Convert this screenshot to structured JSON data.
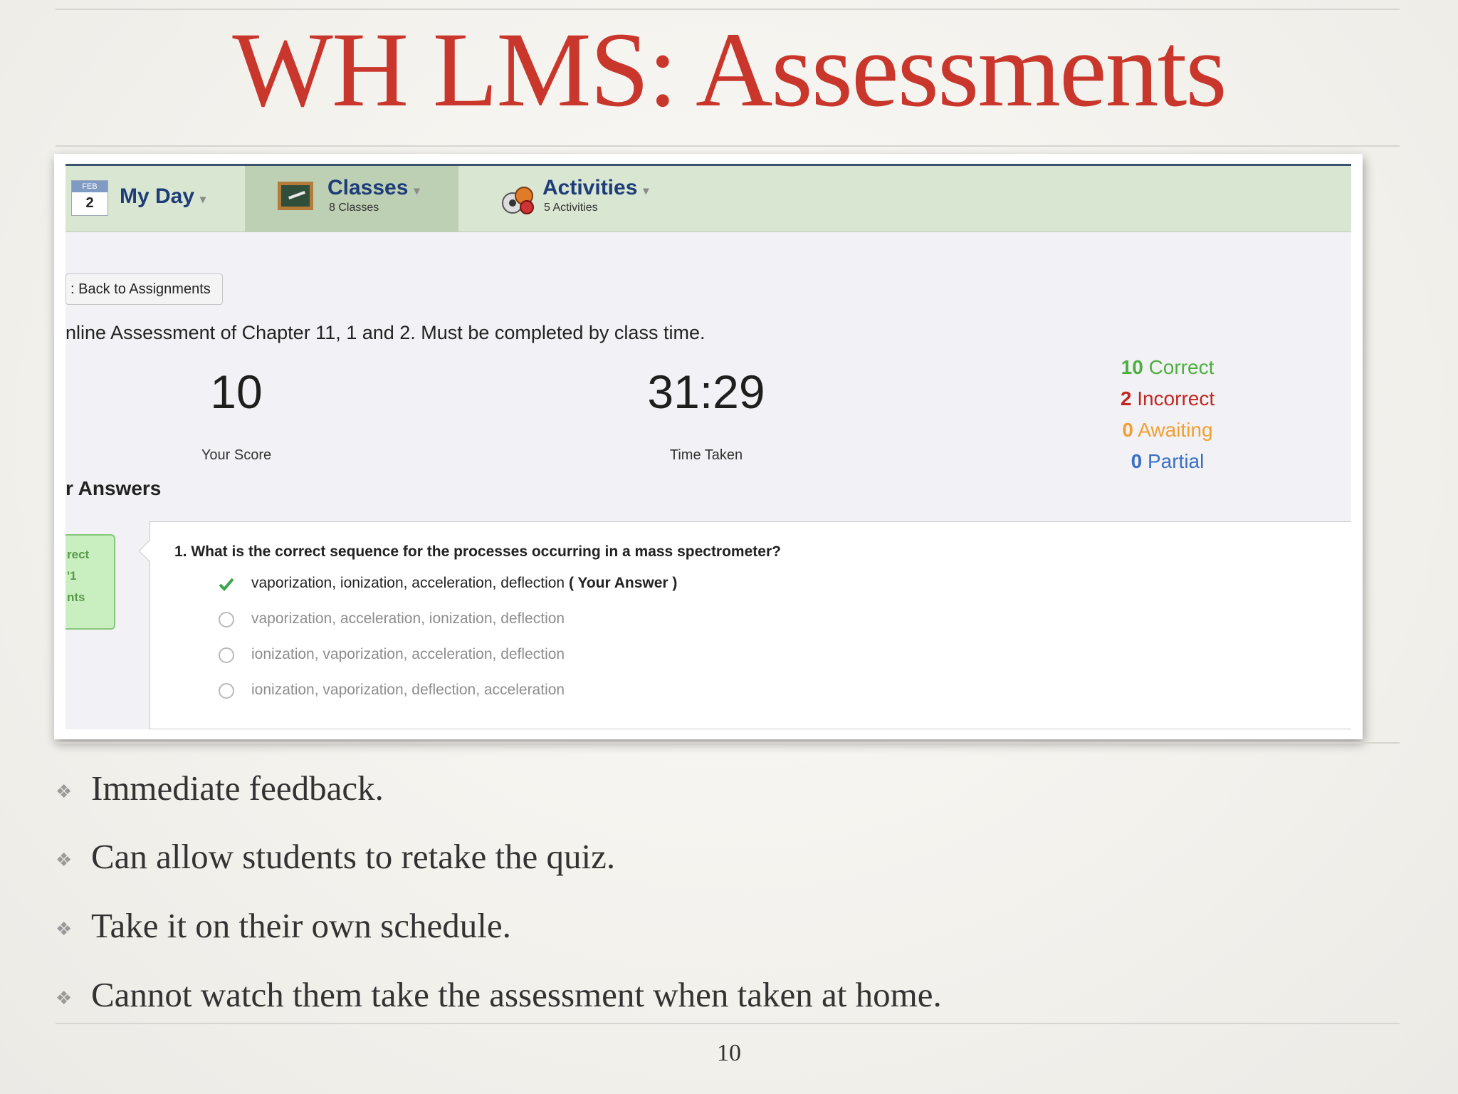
{
  "slide": {
    "title": "WH LMS: Assessments",
    "page_number": "10",
    "bullets": [
      "Immediate feedback.",
      "Can allow students to retake the quiz.",
      "Take it on their own schedule.",
      "Cannot watch them take the assessment when taken at home."
    ]
  },
  "nav": {
    "myday": {
      "month": "FEB",
      "day": "2",
      "label": "My Day"
    },
    "classes": {
      "label": "Classes",
      "sub": "8 Classes"
    },
    "activities": {
      "label": "Activities",
      "sub": "5 Activities"
    },
    "caret": "▾"
  },
  "assessment": {
    "back_label": ": Back to Assignments",
    "title": "nline Assessment of Chapter 11, 1 and 2. Must be completed by class time.",
    "score": "10",
    "score_label": "Your Score",
    "time": "31:29",
    "time_label": "Time Taken",
    "stats": [
      {
        "count": "10",
        "label": "Correct",
        "color": "#4caf3f"
      },
      {
        "count": "2",
        "label": "Incorrect",
        "color": "#c0281f"
      },
      {
        "count": "0",
        "label": "Awaiting",
        "color": "#f0a030"
      },
      {
        "count": "0",
        "label": "Partial",
        "color": "#3a6fc4"
      }
    ],
    "answers_heading": "r Answers",
    "badge": {
      "line1": "rect",
      "line2": "'1",
      "line3": "nts"
    },
    "question": {
      "text": "1. What is the correct sequence for the processes occurring in a mass spectrometer?",
      "options": [
        {
          "text": "vaporization, ionization, acceleration, deflection",
          "note": "( Your Answer )",
          "selected": true
        },
        {
          "text": "vaporization, acceleration, ionization, deflection"
        },
        {
          "text": "ionization, vaporization, acceleration, deflection"
        },
        {
          "text": "ionization, vaporization, deflection, acceleration"
        }
      ]
    }
  },
  "colors": {
    "title_red": "#c9372c",
    "nav_blue": "#1d3c78",
    "check_green": "#3aa54a"
  }
}
